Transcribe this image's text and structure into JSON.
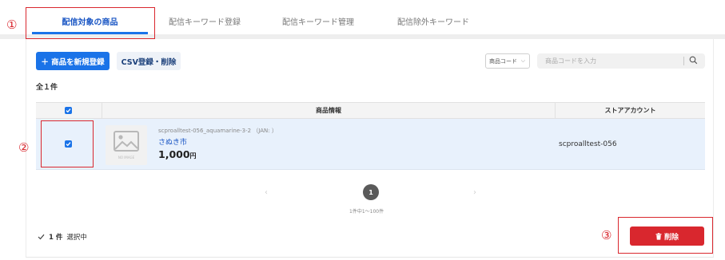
{
  "tabs": [
    {
      "label": "配信対象の商品",
      "active": true
    },
    {
      "label": "配信キーワード登録",
      "active": false
    },
    {
      "label": "配信キーワード管理",
      "active": false
    },
    {
      "label": "配信除外キーワード",
      "active": false
    }
  ],
  "annotations": [
    "①",
    "②",
    "③"
  ],
  "toolbar": {
    "add_label": "＋ 商品を新規登録",
    "csv_label": "CSV登録・削除",
    "filter_select": "商品コード",
    "search_placeholder": "商品コードを入力"
  },
  "total_count": "全１件",
  "table": {
    "headers": [
      "商品情報",
      "ストアアカウント"
    ],
    "rows": [
      {
        "checked": true,
        "code": "scproalltest-056_aquamarine-3-2 （JAN: ）",
        "name": "さぬき市",
        "price": "1,000",
        "price_unit": "円",
        "thumb_text": "NO IMAGE",
        "store_account": "scproalltest-056"
      }
    ]
  },
  "pagination": {
    "prev": "‹",
    "current": "1",
    "next": "›",
    "info": "1件中1～100件"
  },
  "footer": {
    "selected_count": "1 件",
    "selected_label": "選択中",
    "delete_label": "削除"
  },
  "colors": {
    "accent": "#1a73e8",
    "danger": "#d9272e",
    "row_selected": "#e8f1fc"
  }
}
